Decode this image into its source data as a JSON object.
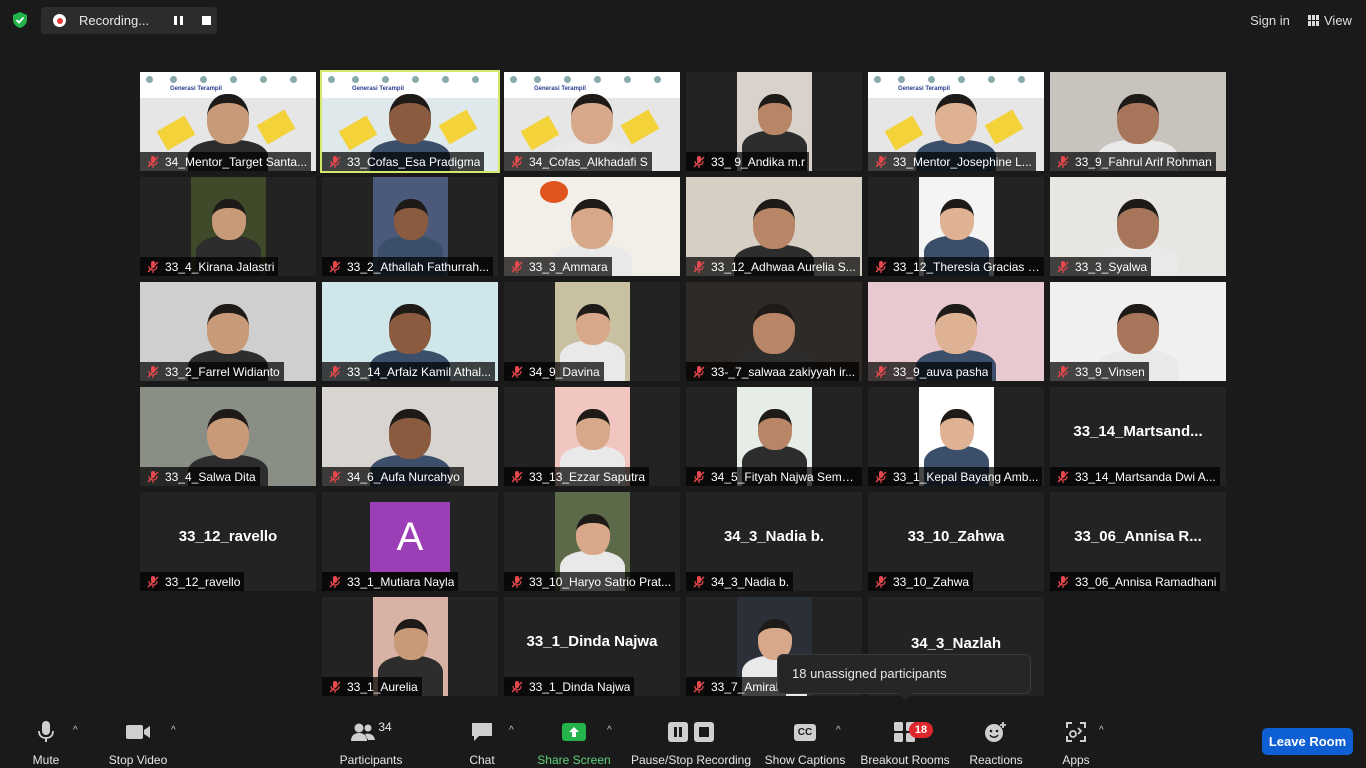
{
  "recording": {
    "label": "Recording..."
  },
  "header": {
    "signin": "Sign in",
    "view": "View"
  },
  "tiles": [
    "34_Mentor_Target Santa...",
    "33_Cofas_Esa Pradigma",
    "34_Cofas_Alkhadafi S",
    "33_ 9_Andika m.r",
    "33_Mentor_Josephine L...",
    "33_9_Fahrul Arif Rohman",
    "33_4_Kirana Jalastri",
    "33_2_Athallah Fathurrah...",
    "33_3_Ammara",
    "33_12_Adhwaa Aurelia S...",
    "33_12_Theresia Gracias I...",
    "33_3_Syalwa",
    "33_2_Farrel Widianto",
    "33_14_Arfaiz Kamil Athal...",
    "34_9_Davina",
    "33-_7_salwaa zakiyyah ir...",
    "33_9_auva pasha",
    "33_9_Vinsen",
    "33_4_Salwa Dita",
    "34_6_Aufa Nurcahyo",
    "33_13_Ezzar Saputra",
    "34_5_Fityah Najwa Semb...",
    "33_1_Kepal Bayang Amb...",
    "33_14_Martsanda Dwi A...",
    "33_12_ravello",
    "33_1_Mutiara Nayla",
    "33_10_Haryo Satrio Prat...",
    "34_3_Nadia b.",
    "33_10_Zahwa",
    "33_06_Annisa Ramadhani",
    "33_1_Aurelia",
    "33_1_Dinda Najwa",
    "33_7_Amirah"
  ],
  "bignames": {
    "t23": "33_14_Martsand...",
    "t24": "33_12_ravello",
    "t27": "34_3_Nadia b.",
    "t28": "33_10_Zahwa",
    "t29": "33_06_Annisa R...",
    "t31": "33_1_Dinda Najwa",
    "t33": "34_3_Nazlah"
  },
  "avatar_letter": "A",
  "banner_text": "Generasi Terampil",
  "tooltip": "18 unassigned participants",
  "toolbar": {
    "mute": "Mute",
    "stop_video": "Stop Video",
    "participants": "Participants",
    "participants_count": "34",
    "chat": "Chat",
    "share_screen": "Share Screen",
    "pause_stop_recording": "Pause/Stop Recording",
    "show_captions": "Show Captions",
    "captions_icon_text": "CC",
    "breakout_rooms": "Breakout Rooms",
    "breakout_badge": "18",
    "reactions": "Reactions",
    "apps": "Apps",
    "leave_room": "Leave Room"
  },
  "colors": {
    "accent": "#0e5ed4",
    "active_speaker": "#d6e86b",
    "share_green": "#23b34a",
    "badge_red": "#e0262d",
    "muted_red": "#e5484d"
  }
}
